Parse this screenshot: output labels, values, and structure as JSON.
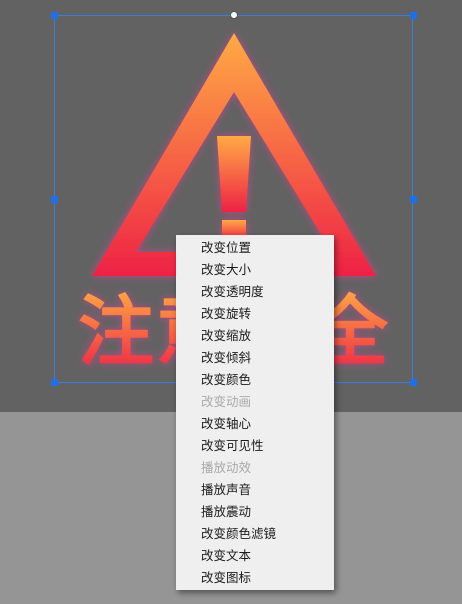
{
  "artwork": {
    "banner_text": "注意安全",
    "colors": {
      "gradient_top": "#ffaa44",
      "gradient_bottom": "#ee2244",
      "glow": "#cc4488"
    }
  },
  "context_menu": {
    "items": [
      {
        "label": "改变位置",
        "enabled": true
      },
      {
        "label": "改变大小",
        "enabled": true
      },
      {
        "label": "改变透明度",
        "enabled": true
      },
      {
        "label": "改变旋转",
        "enabled": true
      },
      {
        "label": "改变缩放",
        "enabled": true
      },
      {
        "label": "改变倾斜",
        "enabled": true
      },
      {
        "label": "改变颜色",
        "enabled": true
      },
      {
        "label": "改变动画",
        "enabled": false
      },
      {
        "label": "改变轴心",
        "enabled": true
      },
      {
        "label": "改变可见性",
        "enabled": true
      },
      {
        "label": "播放动效",
        "enabled": false
      },
      {
        "label": "播放声音",
        "enabled": true
      },
      {
        "label": "播放震动",
        "enabled": true
      },
      {
        "label": "改变颜色滤镜",
        "enabled": true
      },
      {
        "label": "改变文本",
        "enabled": true
      },
      {
        "label": "改变图标",
        "enabled": true
      }
    ]
  }
}
